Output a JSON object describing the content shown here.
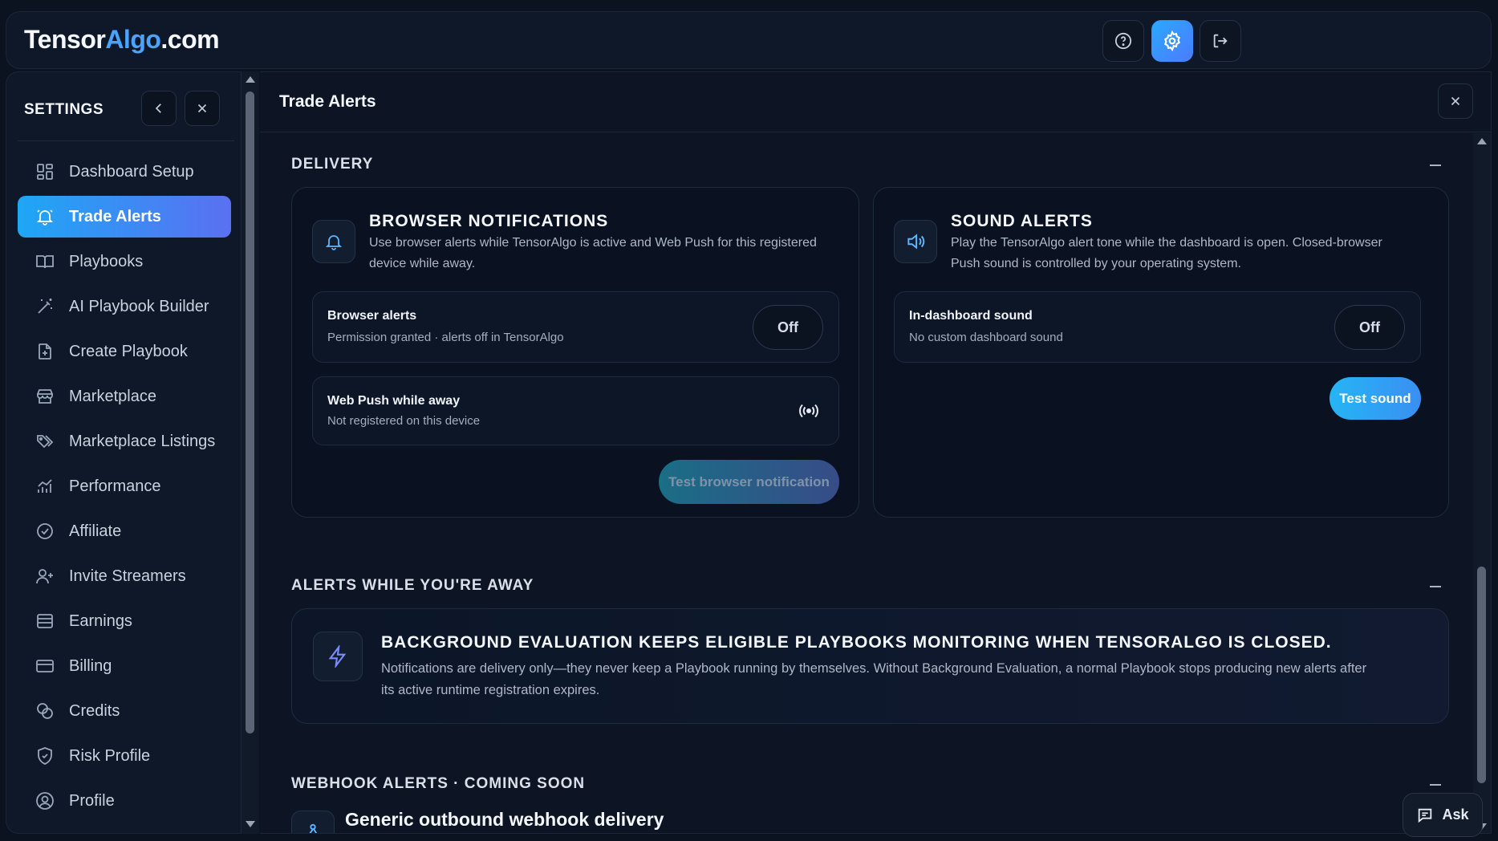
{
  "header": {
    "logo_part1": "Tensor",
    "logo_part2": "Algo",
    "logo_part3": ".com"
  },
  "sidebar": {
    "title": "SETTINGS",
    "items": [
      {
        "label": "Dashboard Setup",
        "icon": "grid-icon"
      },
      {
        "label": "Trade Alerts",
        "icon": "bell-icon",
        "active": true
      },
      {
        "label": "Playbooks",
        "icon": "book-icon"
      },
      {
        "label": "AI Playbook Builder",
        "icon": "magic-wand-icon"
      },
      {
        "label": "Create Playbook",
        "icon": "file-plus-icon"
      },
      {
        "label": "Marketplace",
        "icon": "store-icon"
      },
      {
        "label": "Marketplace Listings",
        "icon": "tags-icon"
      },
      {
        "label": "Performance",
        "icon": "chart-icon"
      },
      {
        "label": "Affiliate",
        "icon": "badge-icon"
      },
      {
        "label": "Invite Streamers",
        "icon": "user-plus-icon"
      },
      {
        "label": "Earnings",
        "icon": "wallet-icon"
      },
      {
        "label": "Billing",
        "icon": "credit-card-icon"
      },
      {
        "label": "Credits",
        "icon": "coins-icon"
      },
      {
        "label": "Risk Profile",
        "icon": "shield-icon"
      },
      {
        "label": "Profile",
        "icon": "user-circle-icon"
      }
    ]
  },
  "main": {
    "title": "Trade Alerts",
    "delivery": {
      "heading": "DELIVERY",
      "browser": {
        "title": "BROWSER NOTIFICATIONS",
        "desc_line1": "Use browser alerts while TensorAlgo is active and Web Push for this registered",
        "desc_line2": "device while away.",
        "alerts_title": "Browser alerts",
        "alerts_sub": "Permission granted · alerts off in TensorAlgo",
        "alerts_toggle": "Off",
        "push_title": "Web Push while away",
        "push_sub": "Not registered on this device",
        "test_button": "Test browser notification"
      },
      "sound": {
        "title": "SOUND ALERTS",
        "desc_line1": "Play the TensorAlgo alert tone while the dashboard is open. Closed-browser",
        "desc_line2": "Push sound is controlled by your operating system.",
        "row_title": "In-dashboard sound",
        "row_sub": "No custom dashboard sound",
        "toggle": "Off",
        "test_button": "Test sound"
      }
    },
    "away": {
      "heading": "ALERTS WHILE YOU'RE AWAY",
      "title": "BACKGROUND EVALUATION KEEPS ELIGIBLE PLAYBOOKS MONITORING WHEN TENSORALGO IS CLOSED.",
      "desc_line1": "Notifications are delivery only—they never keep a Playbook running by themselves. Without Background Evaluation, a normal Playbook stops producing new alerts after",
      "desc_line2": "its active runtime registration expires."
    },
    "webhook": {
      "heading": "WEBHOOK ALERTS · COMING SOON",
      "title": "Generic outbound webhook delivery"
    }
  },
  "ask_label": "Ask",
  "colors": {
    "accent_start": "#1ea7f5",
    "accent_end": "#5a70f2",
    "background": "#0b1220"
  }
}
